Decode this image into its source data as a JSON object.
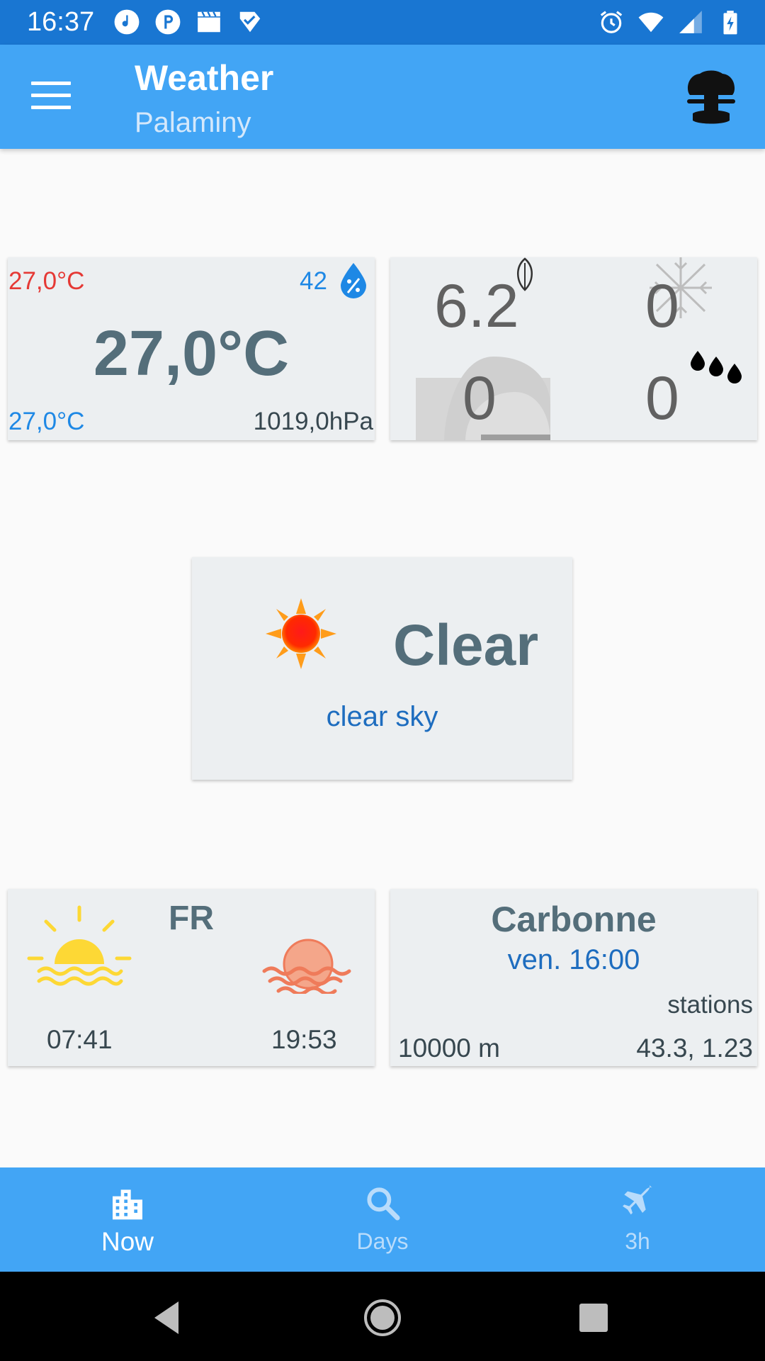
{
  "status_bar": {
    "time": "16:37",
    "left_icons": [
      "music-app-icon",
      "p-app-icon",
      "clapper-icon",
      "check-app-icon"
    ],
    "right_icons": [
      "alarm-icon",
      "wifi-icon",
      "signal-icon",
      "battery-charging-icon"
    ]
  },
  "app_bar": {
    "title": "Weather",
    "subtitle": "Palaminy",
    "menu_icon": "hamburger-menu-icon",
    "action_icon": "mushroom-cloud-icon"
  },
  "temperature_card": {
    "max": "27,0°C",
    "min": "27,0°C",
    "current": "27,0°C",
    "humidity": "42",
    "humidity_icon": "humidity-drop-icon",
    "pressure": "1019,0hPa"
  },
  "wind_card": {
    "wind_speed": "6.2",
    "snow": "0",
    "cloudiness": "0",
    "rain": "0",
    "icons": [
      "wind-leaf-icon",
      "snowflake-icon",
      "cloud-icon",
      "rain-drops-icon"
    ]
  },
  "condition_card": {
    "main": "Clear",
    "description": "clear sky",
    "icon": "sun-icon"
  },
  "sun_card": {
    "country": "FR",
    "sunrise": "07:41",
    "sunset": "19:53",
    "sunrise_icon": "sunrise-icon",
    "sunset_icon": "sunset-icon"
  },
  "location_card": {
    "name": "Carbonne",
    "time": "ven. 16:00",
    "stations_label": "stations",
    "visibility": "10000 m",
    "coordinates": "43.3, 1.23"
  },
  "bottom_nav": {
    "items": [
      {
        "label": "Now",
        "icon": "city-icon",
        "active": true
      },
      {
        "label": "Days",
        "icon": "search-icon",
        "active": false
      },
      {
        "label": "3h",
        "icon": "airplane-icon",
        "active": false
      }
    ]
  },
  "colors": {
    "status_bar": "#1976d2",
    "app_bar": "#42a5f5",
    "card_bg": "#eceff1",
    "max_temp": "#e53935",
    "accent_blue": "#1e88e5",
    "slate_text": "#546e7a"
  }
}
